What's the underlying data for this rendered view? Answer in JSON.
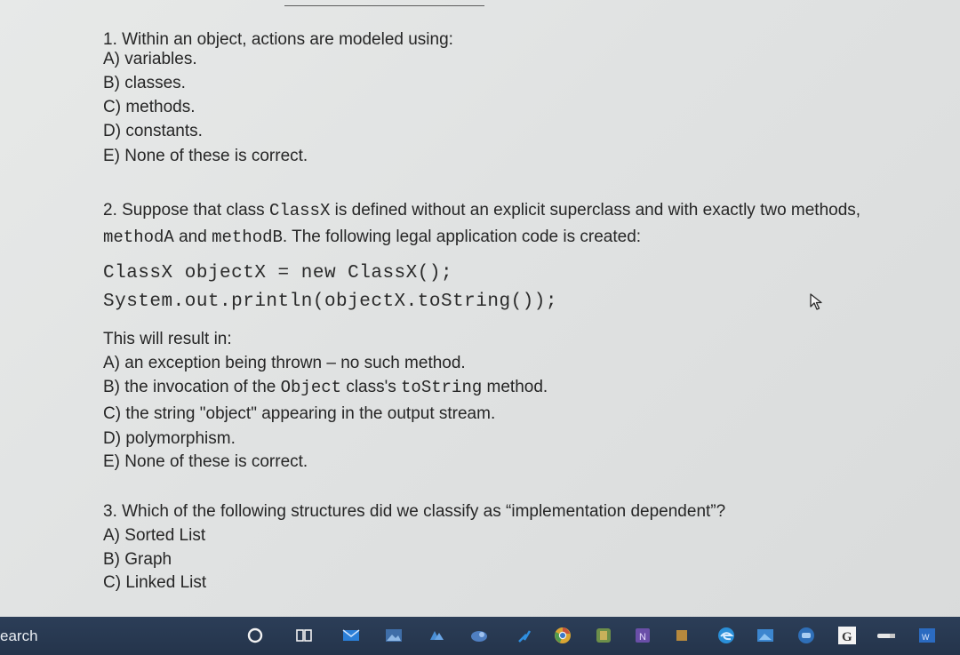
{
  "questions": [
    {
      "prompt": "1. Within an object, actions are modeled using:",
      "options": [
        "A) variables.",
        "B) classes.",
        "C) methods.",
        "D) constants.",
        "E) None of these is correct."
      ]
    },
    {
      "prompt": {
        "part1": "2. Suppose that class ",
        "code1": "ClassX",
        "part2": " is defined without an explicit superclass and with exactly two methods,",
        "line2_code1": "methodA",
        "line2_part1": " and ",
        "line2_code2": "methodB",
        "line2_part2": ". The following legal application code is created:"
      },
      "code": [
        "ClassX objectX = new ClassX();",
        "System.out.println(objectX.toString());"
      ],
      "lead": "This will result in:",
      "options": {
        "a": "A) an exception being thrown – no such method.",
        "b_part1": "B) the invocation of the ",
        "b_code1": "Object",
        "b_part2": " class's ",
        "b_code2": "toString",
        "b_part3": " method.",
        "c": "C) the string \"object\" appearing in the output stream.",
        "d": "D) polymorphism.",
        "e": "E) None of these is correct."
      }
    },
    {
      "prompt": "3. Which of the following structures did we classify as “implementation dependent”?",
      "options": [
        "A) Sorted List",
        "B) Graph",
        "C) Linked List"
      ]
    }
  ],
  "taskbar": {
    "search_text": "earch",
    "icons": [
      "cortana-circle-icon",
      "task-view-icon",
      "mail-icon",
      "photos-icon",
      "onedrive-icon",
      "app-icon",
      "app-arrow-icon",
      "chrome-icon",
      "app-icon",
      "onenote-icon",
      "app-icon",
      "edge-icon",
      "app-icon",
      "app-icon",
      "google-app-icon",
      "pen-icon",
      "word-icon"
    ]
  }
}
